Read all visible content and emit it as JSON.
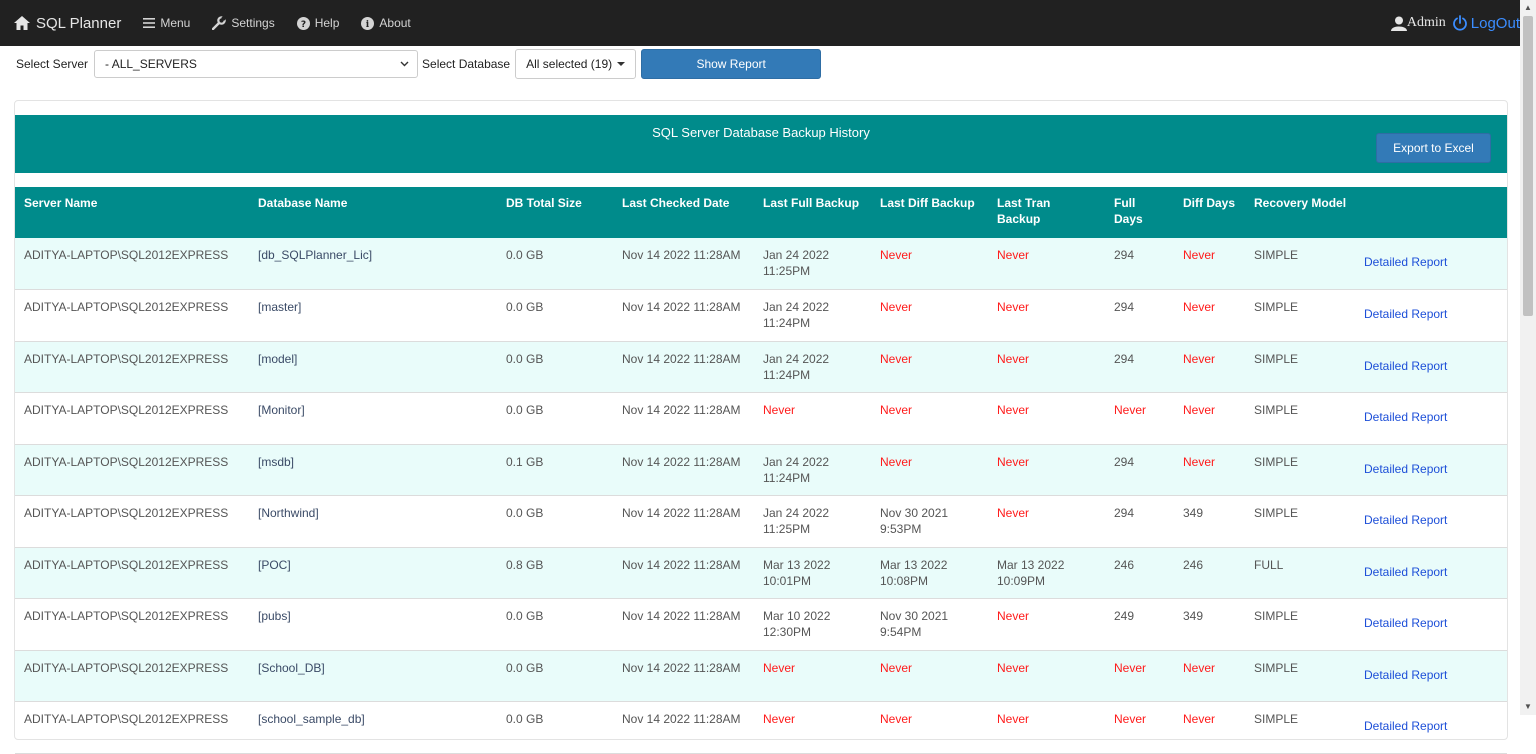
{
  "nav": {
    "brand": "SQL Planner",
    "menu": "Menu",
    "settings": "Settings",
    "help": "Help",
    "about": "About",
    "user": "Admin",
    "logout": "LogOut"
  },
  "filters": {
    "server_label": "Select Server",
    "server_value": "- ALL_SERVERS",
    "db_label": "Select Database",
    "db_value": "All selected (19)",
    "show_button": "Show Report"
  },
  "report": {
    "title": "SQL Server Database Backup History",
    "export_button": "Export to Excel",
    "columns": [
      "Server Name",
      "Database Name",
      "DB Total Size",
      "Last Checked Date",
      "Last Full Backup",
      "Last Diff Backup",
      "Last Tran Backup",
      "Full Days",
      "Diff Days",
      "Recovery Model",
      ""
    ],
    "link_label": "Detailed Report",
    "rows": [
      [
        "ADITYA-LAPTOP\\SQL2012EXPRESS",
        "[db_SQLPlanner_Lic]",
        "0.0 GB",
        "Nov 14 2022 11:28AM",
        "Jan 24 2022 11:25PM",
        "Never",
        "Never",
        "294",
        "Never",
        "SIMPLE"
      ],
      [
        "ADITYA-LAPTOP\\SQL2012EXPRESS",
        "[master]",
        "0.0 GB",
        "Nov 14 2022 11:28AM",
        "Jan 24 2022 11:24PM",
        "Never",
        "Never",
        "294",
        "Never",
        "SIMPLE"
      ],
      [
        "ADITYA-LAPTOP\\SQL2012EXPRESS",
        "[model]",
        "0.0 GB",
        "Nov 14 2022 11:28AM",
        "Jan 24 2022 11:24PM",
        "Never",
        "Never",
        "294",
        "Never",
        "SIMPLE"
      ],
      [
        "ADITYA-LAPTOP\\SQL2012EXPRESS",
        "[Monitor]",
        "0.0 GB",
        "Nov 14 2022 11:28AM",
        "Never",
        "Never",
        "Never",
        "Never",
        "Never",
        "SIMPLE"
      ],
      [
        "ADITYA-LAPTOP\\SQL2012EXPRESS",
        "[msdb]",
        "0.1 GB",
        "Nov 14 2022 11:28AM",
        "Jan 24 2022 11:24PM",
        "Never",
        "Never",
        "294",
        "Never",
        "SIMPLE"
      ],
      [
        "ADITYA-LAPTOP\\SQL2012EXPRESS",
        "[Northwind]",
        "0.0 GB",
        "Nov 14 2022 11:28AM",
        "Jan 24 2022 11:25PM",
        "Nov 30 2021 9:53PM",
        "Never",
        "294",
        "349",
        "SIMPLE"
      ],
      [
        "ADITYA-LAPTOP\\SQL2012EXPRESS",
        "[POC]",
        "0.8 GB",
        "Nov 14 2022 11:28AM",
        "Mar 13 2022 10:01PM",
        "Mar 13 2022 10:08PM",
        "Mar 13 2022 10:09PM",
        "246",
        "246",
        "FULL"
      ],
      [
        "ADITYA-LAPTOP\\SQL2012EXPRESS",
        "[pubs]",
        "0.0 GB",
        "Nov 14 2022 11:28AM",
        "Mar 10 2022 12:30PM",
        "Nov 30 2021 9:54PM",
        "Never",
        "249",
        "349",
        "SIMPLE"
      ],
      [
        "ADITYA-LAPTOP\\SQL2012EXPRESS",
        "[School_DB]",
        "0.0 GB",
        "Nov 14 2022 11:28AM",
        "Never",
        "Never",
        "Never",
        "Never",
        "Never",
        "SIMPLE"
      ],
      [
        "ADITYA-LAPTOP\\SQL2012EXPRESS",
        "[school_sample_db]",
        "0.0 GB",
        "Nov 14 2022 11:28AM",
        "Never",
        "Never",
        "Never",
        "Never",
        "Never",
        "SIMPLE"
      ]
    ]
  },
  "colors": {
    "navbar": "#212121",
    "teal": "#008b8b",
    "row_alt": "#e9fcfa",
    "never": "#ff1a1a",
    "link": "#1d4fd8",
    "button": "#337ab7"
  },
  "icons": [
    "home-icon",
    "menu-icon",
    "wrench-icon",
    "help-icon",
    "info-icon",
    "user-icon",
    "power-icon",
    "chevron-down-icon"
  ]
}
